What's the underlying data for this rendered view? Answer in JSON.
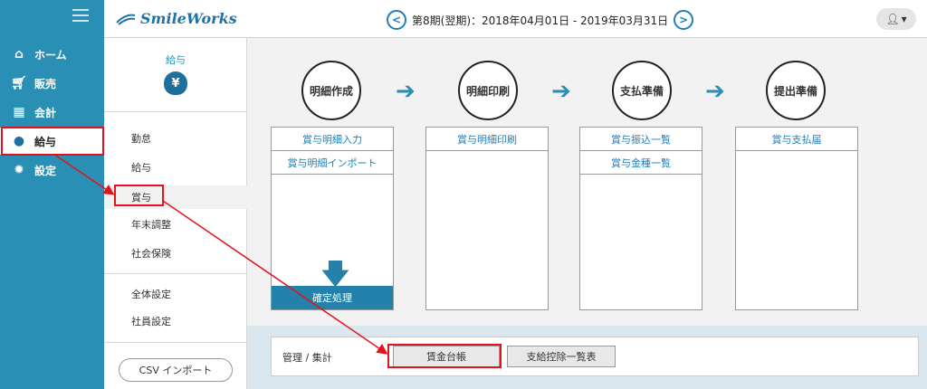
{
  "app": {
    "logo": "SmileWorks"
  },
  "header": {
    "period": "第8期(翌期)：2018年04月01日 - 2019年03月31日",
    "prev_icon": "chevron-left-icon",
    "next_icon": "chevron-right-icon",
    "user_icon": "user-icon"
  },
  "nav": {
    "items": [
      {
        "label": "ホーム",
        "icon": "home-icon"
      },
      {
        "label": "販売",
        "icon": "cart-icon"
      },
      {
        "label": "会計",
        "icon": "calculator-icon"
      },
      {
        "label": "給与",
        "icon": "money-bag-icon"
      },
      {
        "label": "設定",
        "icon": "gear-icon"
      }
    ]
  },
  "submenu": {
    "title": "給与",
    "bag_symbol": "¥",
    "items": [
      "勤怠",
      "給与",
      "賞与",
      "年末調整",
      "社会保険",
      "全体設定",
      "社員設定"
    ],
    "csv_button": "CSV インポート"
  },
  "steps": [
    "明細作成",
    "明細印刷",
    "支払準備",
    "提出準備"
  ],
  "columns": {
    "col1": [
      "賞与明細入力",
      "賞与明細インポート"
    ],
    "col1_button": "確定処理",
    "col2": [
      "賞与明細印刷"
    ],
    "col3": [
      "賞与振込一覧",
      "賞与金種一覧"
    ],
    "col4": [
      "賞与支払届"
    ]
  },
  "management": {
    "label": "管理 / 集計",
    "buttons": [
      "賃金台帳",
      "支給控除一覧表"
    ]
  },
  "colors": {
    "accent": "#2a8fb5",
    "highlight": "#e0141e"
  }
}
